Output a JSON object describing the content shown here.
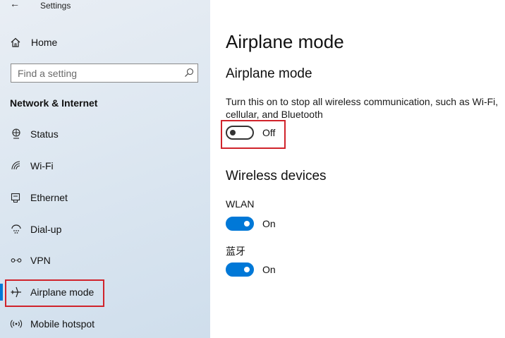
{
  "window": {
    "title": "Settings"
  },
  "sidebar": {
    "home_label": "Home",
    "search_placeholder": "Find a setting",
    "section_title": "Network & Internet",
    "items": [
      {
        "label": "Status",
        "icon": "status-icon"
      },
      {
        "label": "Wi-Fi",
        "icon": "wifi-icon"
      },
      {
        "label": "Ethernet",
        "icon": "ethernet-icon"
      },
      {
        "label": "Dial-up",
        "icon": "dial-up-icon"
      },
      {
        "label": "VPN",
        "icon": "vpn-icon"
      },
      {
        "label": "Airplane mode",
        "icon": "airplane-icon",
        "selected": true
      },
      {
        "label": "Mobile hotspot",
        "icon": "mobile-hotspot-icon"
      }
    ]
  },
  "main": {
    "page_title": "Airplane mode",
    "airplane": {
      "heading": "Airplane mode",
      "description": "Turn this on to stop all wireless communication, such as Wi-Fi, cellular, and Bluetooth",
      "toggle_state": "Off"
    },
    "wireless": {
      "heading": "Wireless devices",
      "devices": [
        {
          "label": "WLAN",
          "state": "On"
        },
        {
          "label": "蓝牙",
          "state": "On"
        }
      ]
    }
  },
  "colors": {
    "accent": "#0078d7",
    "highlight": "#d0232b"
  }
}
